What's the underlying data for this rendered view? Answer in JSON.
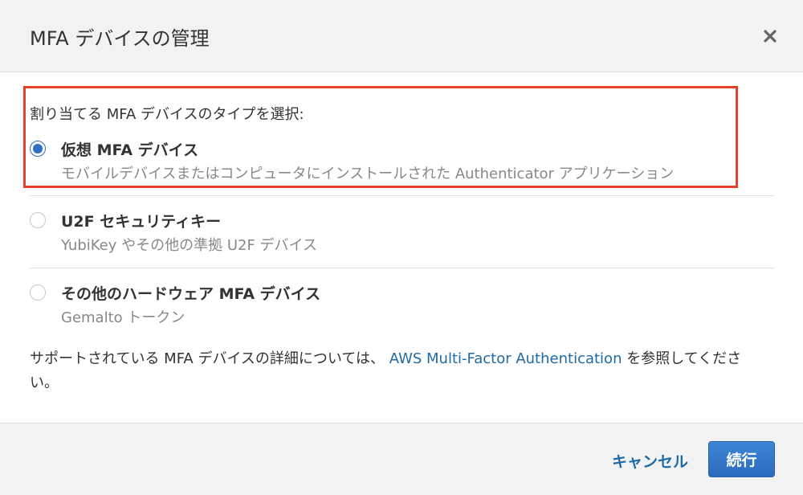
{
  "dialog": {
    "title": "MFA デバイスの管理"
  },
  "selection": {
    "prompt": "割り当てる MFA デバイスのタイプを選択:",
    "options": [
      {
        "title": "仮想 MFA デバイス",
        "description": "モバイルデバイスまたはコンピュータにインストールされた Authenticator アプリケーション",
        "selected": true
      },
      {
        "title": "U2F セキュリティキー",
        "description": "YubiKey やその他の準拠 U2F デバイス",
        "selected": false
      },
      {
        "title": "その他のハードウェア MFA デバイス",
        "description": "Gemalto トークン",
        "selected": false
      }
    ]
  },
  "info": {
    "text_before": "サポートされている MFA デバイスの詳細については、",
    "link": "AWS Multi-Factor Authentication",
    "text_after": "を参照してください。"
  },
  "footer": {
    "cancel_label": "キャンセル",
    "continue_label": "続行"
  },
  "colors": {
    "accent": "#2f6fc7",
    "link": "#1f6aa5",
    "highlight_border": "#e8402a",
    "primary_button": "#2a6bbd"
  },
  "icons": {
    "close": "close-icon"
  }
}
